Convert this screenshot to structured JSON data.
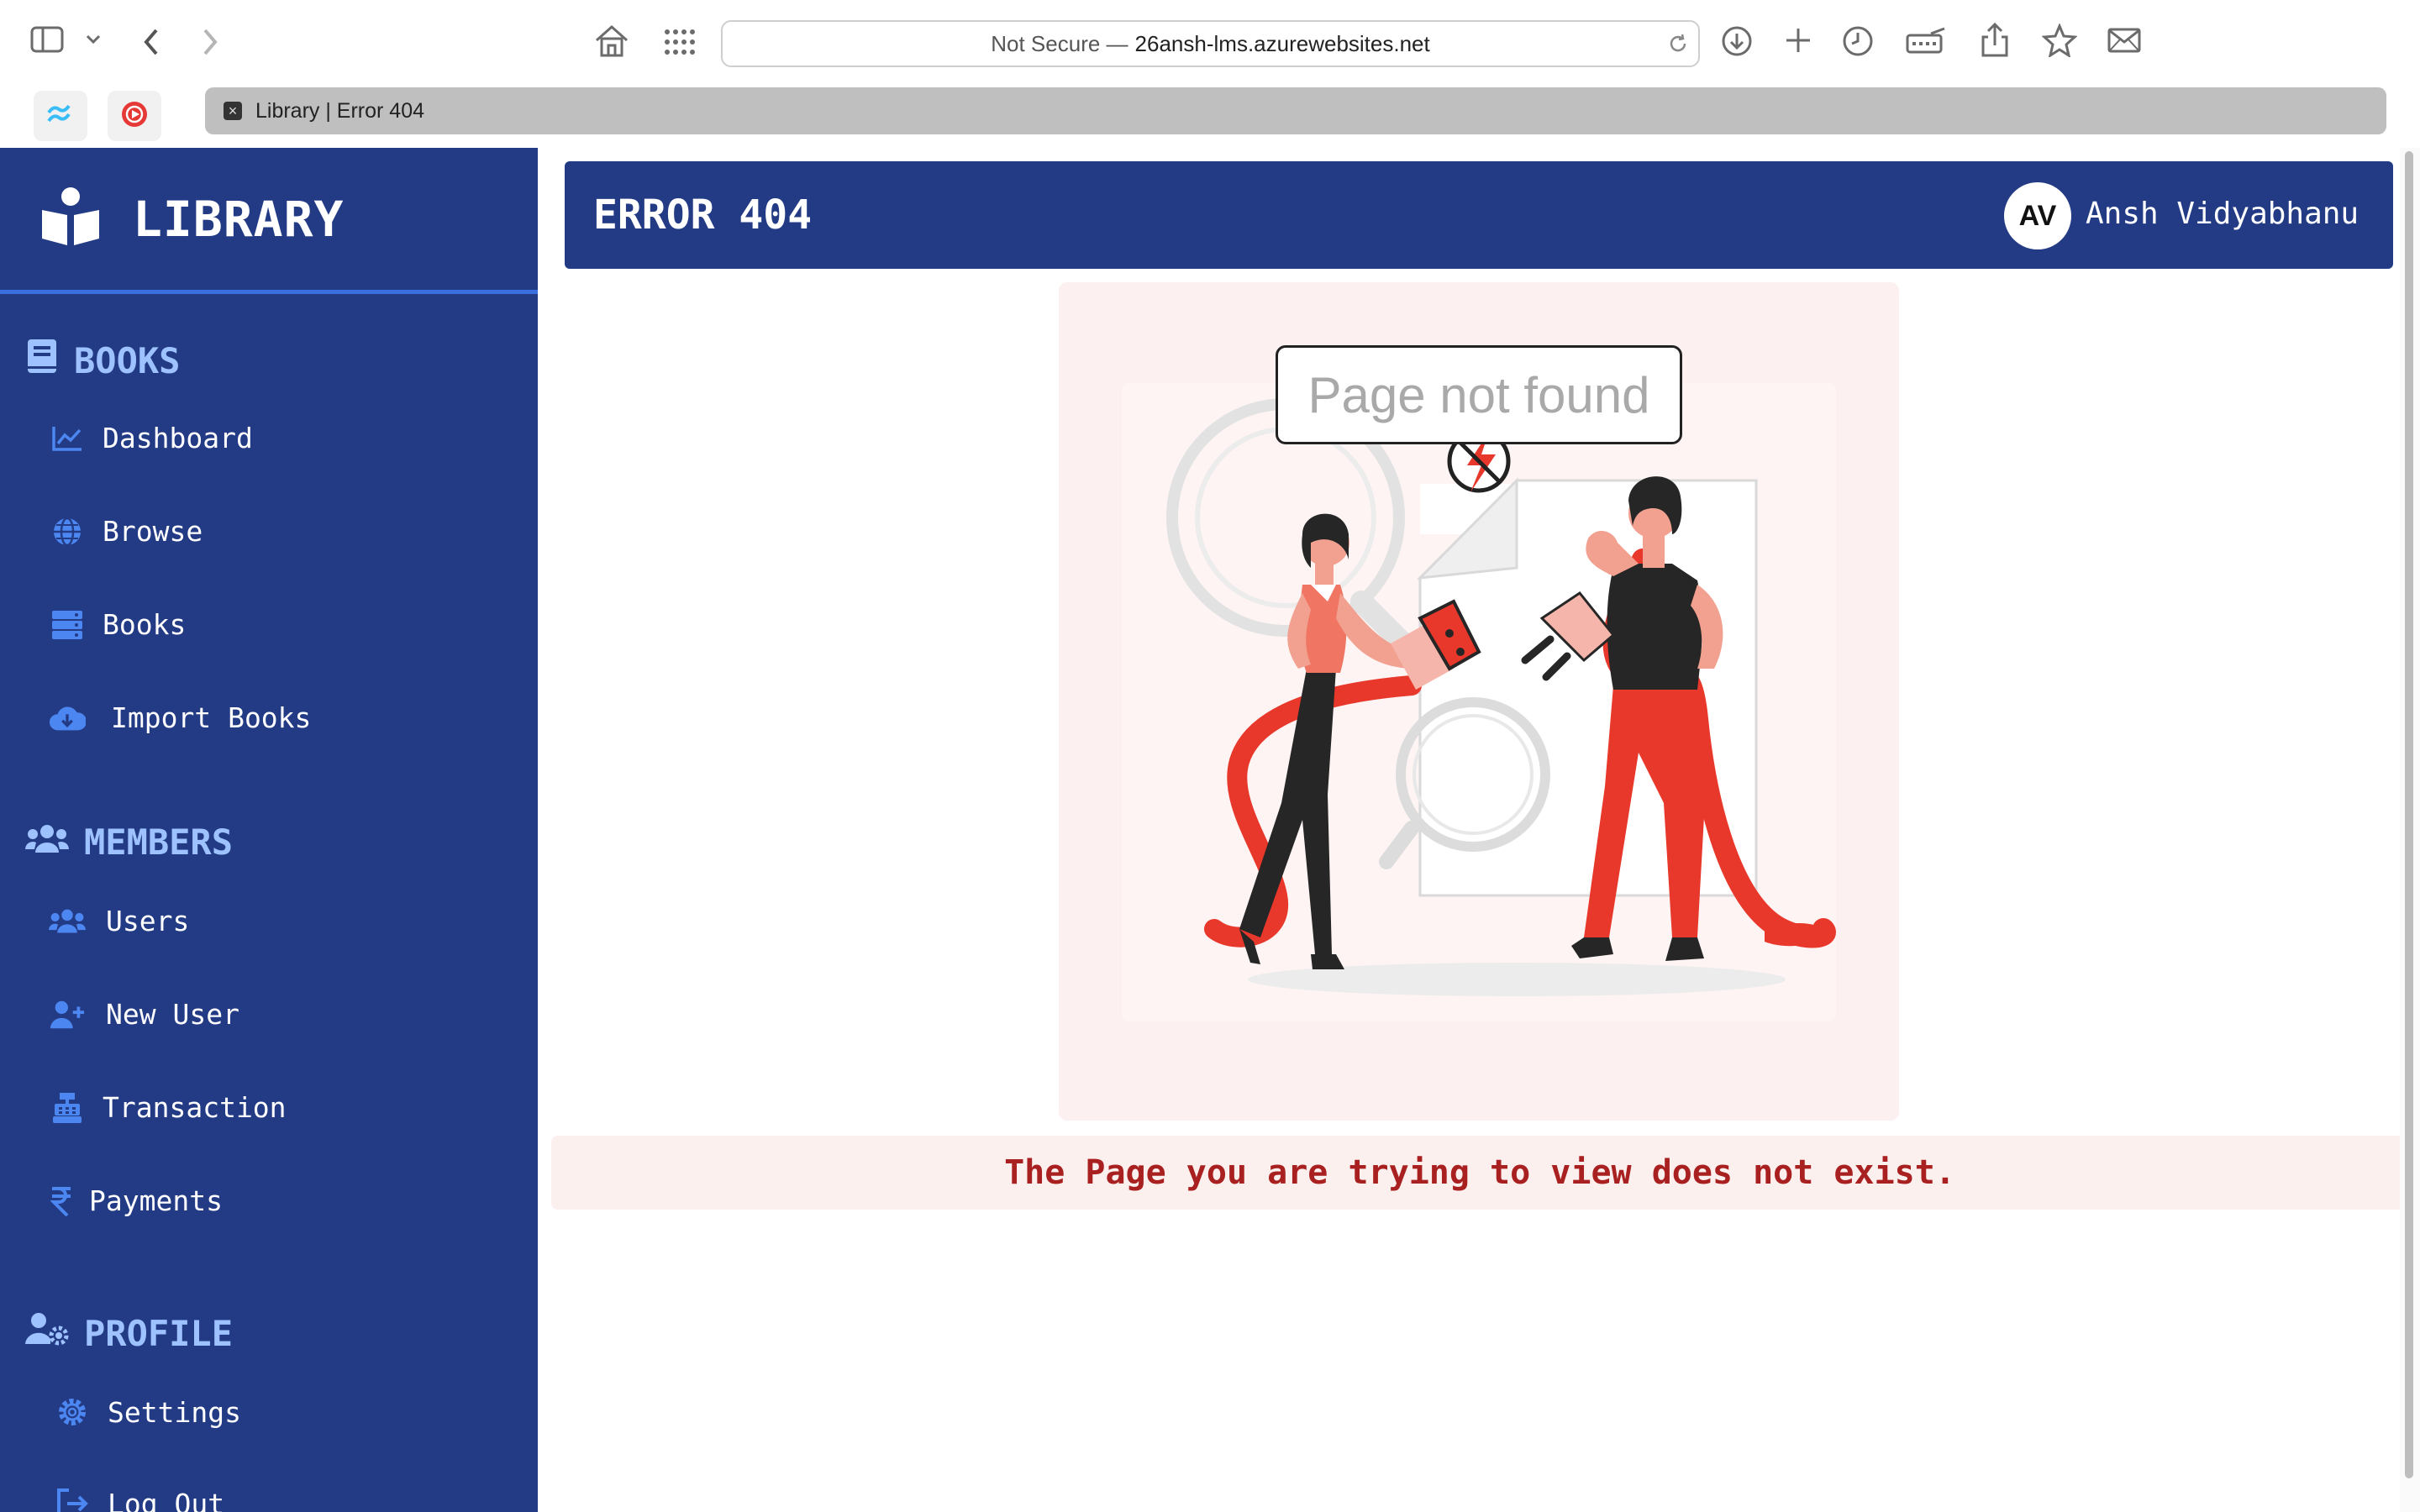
{
  "browser": {
    "address_prefix": "Not Secure —",
    "address_host": "26ansh-lms.azurewebsites.net",
    "tab_title": "Library | Error 404"
  },
  "sidebar": {
    "brand": "LIBRARY",
    "sections": [
      {
        "label": "BOOKS",
        "icon": "book-icon",
        "items": [
          {
            "label": "Dashboard",
            "icon": "chart-line-icon"
          },
          {
            "label": "Browse",
            "icon": "globe-icon"
          },
          {
            "label": "Books",
            "icon": "server-stack-icon"
          },
          {
            "label": "Import Books",
            "icon": "cloud-download-icon"
          }
        ]
      },
      {
        "label": "MEMBERS",
        "icon": "users-icon",
        "items": [
          {
            "label": "Users",
            "icon": "users-icon"
          },
          {
            "label": "New User",
            "icon": "user-plus-icon"
          },
          {
            "label": "Transaction",
            "icon": "cash-register-icon"
          },
          {
            "label": "Payments",
            "icon": "rupee-icon"
          }
        ]
      },
      {
        "label": "PROFILE",
        "icon": "user-cog-icon",
        "items": [
          {
            "label": "Settings",
            "icon": "gear-icon"
          },
          {
            "label": "Log Out",
            "icon": "logout-icon"
          }
        ]
      }
    ]
  },
  "header": {
    "title": "ERROR 404",
    "avatar_initials": "AV",
    "user_name": "Ansh Vidyabhanu"
  },
  "illustration": {
    "caption": "Page not found"
  },
  "message": "The Page you are trying to view does not exist.",
  "colors": {
    "sidebar_bg": "#233b85",
    "accent_blue": "#3b6fe0",
    "section_label": "#9ec2ff",
    "error_red": "#a8201f",
    "illustration_red": "#e8382b"
  }
}
